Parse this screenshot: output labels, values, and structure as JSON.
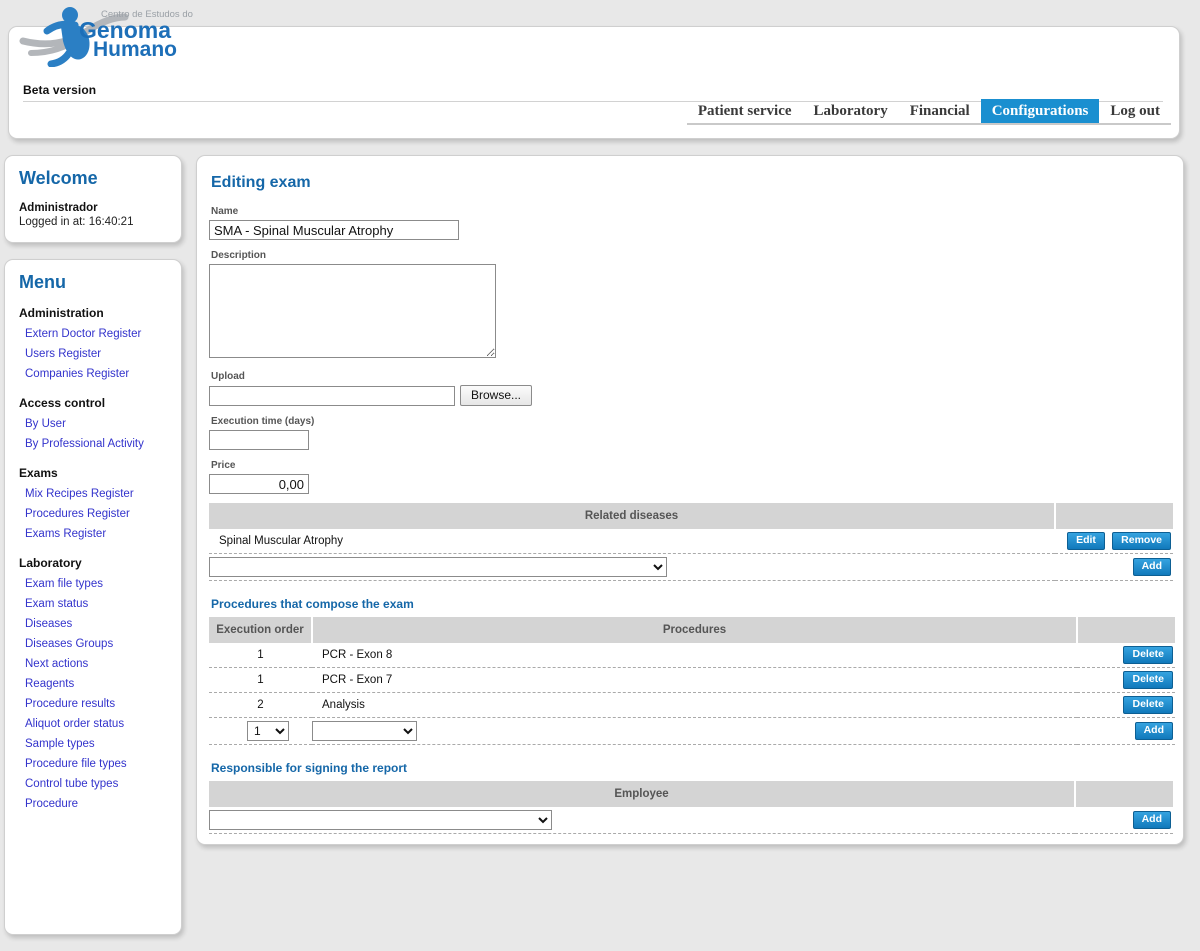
{
  "header": {
    "logo": {
      "top_text": "Centro de Estudos do",
      "line1": "Genoma",
      "line2": "Humano",
      "icon": "human-figure-dna-logo"
    },
    "beta_label": "Beta version",
    "nav": [
      {
        "label": "Patient service",
        "active": false
      },
      {
        "label": "Laboratory",
        "active": false
      },
      {
        "label": "Financial",
        "active": false
      },
      {
        "label": "Configurations",
        "active": true
      },
      {
        "label": "Log out",
        "active": false
      }
    ]
  },
  "sidebar": {
    "welcome": {
      "title": "Welcome",
      "user": "Administrador",
      "login_time": "Logged in at: 16:40:21"
    },
    "menu": {
      "title": "Menu",
      "groups": [
        {
          "title": "Administration",
          "items": [
            "Extern Doctor Register",
            "Users Register",
            "Companies Register"
          ]
        },
        {
          "title": "Access control",
          "items": [
            "By User",
            "By Professional Activity"
          ]
        },
        {
          "title": "Exams",
          "items": [
            "Mix Recipes Register",
            "Procedures Register",
            "Exams Register"
          ]
        },
        {
          "title": "Laboratory",
          "items": [
            "Exam file types",
            "Exam status",
            "Diseases",
            "Diseases Groups",
            "Next actions",
            "Reagents",
            "Procedure results",
            "Aliquot order status",
            "Sample types",
            "Procedure file types",
            "Control tube types",
            "Procedure"
          ]
        }
      ]
    }
  },
  "main": {
    "title": "Editing exam",
    "fields": {
      "name_label": "Name",
      "name_value": "SMA - Spinal Muscular Atrophy",
      "description_label": "Description",
      "description_value": "",
      "upload_label": "Upload",
      "upload_value": "",
      "browse_label": "Browse...",
      "execution_time_label": "Execution time (days)",
      "execution_time_value": "",
      "price_label": "Price",
      "price_value": "0,00"
    },
    "related_diseases": {
      "header": "Related diseases",
      "rows": [
        {
          "name": "Spinal Muscular Atrophy",
          "edit_label": "Edit",
          "remove_label": "Remove"
        }
      ],
      "add_select_value": "",
      "add_label": "Add"
    },
    "procedures": {
      "section_title": "Procedures that compose the exam",
      "columns": [
        "Execution order",
        "Procedures",
        ""
      ],
      "rows": [
        {
          "order": "1",
          "procedure": "PCR - Exon 8",
          "delete_label": "Delete"
        },
        {
          "order": "1",
          "procedure": "PCR - Exon 7",
          "delete_label": "Delete"
        },
        {
          "order": "2",
          "procedure": "Analysis",
          "delete_label": "Delete"
        }
      ],
      "new_order_value": "1",
      "new_procedure_value": "",
      "add_label": "Add"
    },
    "responsible": {
      "section_title": "Responsible for signing the report",
      "column": "Employee",
      "select_value": "",
      "add_label": "Add"
    }
  },
  "colors": {
    "accent_blue": "#1a8fd0",
    "heading_blue": "#1567a8",
    "link_blue": "#3333cc",
    "table_header_gray": "#d4d4d4",
    "page_bg": "#e8e8e8"
  }
}
